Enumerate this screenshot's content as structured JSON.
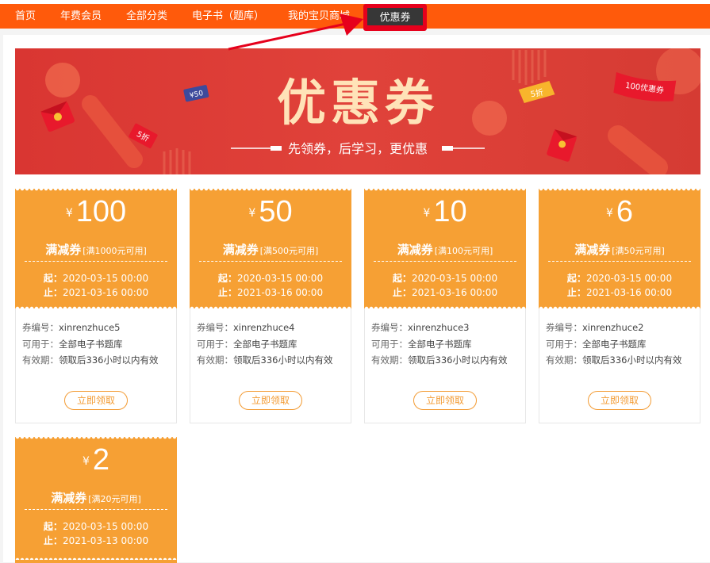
{
  "nav": {
    "items": [
      {
        "label": "首页"
      },
      {
        "label": "年费会员"
      },
      {
        "label": "全部分类"
      },
      {
        "label": "电子书（题库）"
      },
      {
        "label": "我的宝贝商城"
      }
    ],
    "active_label": "优惠券"
  },
  "banner": {
    "title": "优惠券",
    "subtitle": "先领券，后学习，更优惠",
    "tags": {
      "left_blue": "¥50",
      "left_red": "5折",
      "right_yellow": "5折",
      "right_red": "100优惠券"
    }
  },
  "colors": {
    "nav_bg": "#ff5a0b",
    "nav_active_bg": "#373737",
    "highlight": "#e6001c",
    "coupon_orange": "#f6a034",
    "banner_red": "#d93632",
    "banner_text": "#ffe3b8"
  },
  "coupons": [
    {
      "currency": "¥",
      "amount": "100",
      "type": "满减券",
      "condition": "[满1000元可用]",
      "start_label": "起：",
      "start": "2020-03-15 00:00",
      "end_label": "止：",
      "end": "2021-03-16 00:00",
      "code_label": "券编号：",
      "code": "xinrenzhuce5",
      "scope_label": "可用于：",
      "scope": "全部电子书题库",
      "validity_label": "有效期：",
      "validity": "领取后336小时以内有效",
      "button": "立即领取"
    },
    {
      "currency": "¥",
      "amount": "50",
      "type": "满减券",
      "condition": "[满500元可用]",
      "start_label": "起：",
      "start": "2020-03-15 00:00",
      "end_label": "止：",
      "end": "2021-03-16 00:00",
      "code_label": "券编号：",
      "code": "xinrenzhuce4",
      "scope_label": "可用于：",
      "scope": "全部电子书题库",
      "validity_label": "有效期：",
      "validity": "领取后336小时以内有效",
      "button": "立即领取"
    },
    {
      "currency": "¥",
      "amount": "10",
      "type": "满减券",
      "condition": "[满100元可用]",
      "start_label": "起：",
      "start": "2020-03-15 00:00",
      "end_label": "止：",
      "end": "2021-03-16 00:00",
      "code_label": "券编号：",
      "code": "xinrenzhuce3",
      "scope_label": "可用于：",
      "scope": "全部电子书题库",
      "validity_label": "有效期：",
      "validity": "领取后336小时以内有效",
      "button": "立即领取"
    },
    {
      "currency": "¥",
      "amount": "6",
      "type": "满减券",
      "condition": "[满50元可用]",
      "start_label": "起：",
      "start": "2020-03-15 00:00",
      "end_label": "止：",
      "end": "2021-03-16 00:00",
      "code_label": "券编号：",
      "code": "xinrenzhuce2",
      "scope_label": "可用于：",
      "scope": "全部电子书题库",
      "validity_label": "有效期：",
      "validity": "领取后336小时以内有效",
      "button": "立即领取"
    },
    {
      "currency": "¥",
      "amount": "2",
      "type": "满减券",
      "condition": "[满20元可用]",
      "start_label": "起：",
      "start": "2020-03-15 00:00",
      "end_label": "止：",
      "end": "2021-03-13 00:00"
    }
  ]
}
